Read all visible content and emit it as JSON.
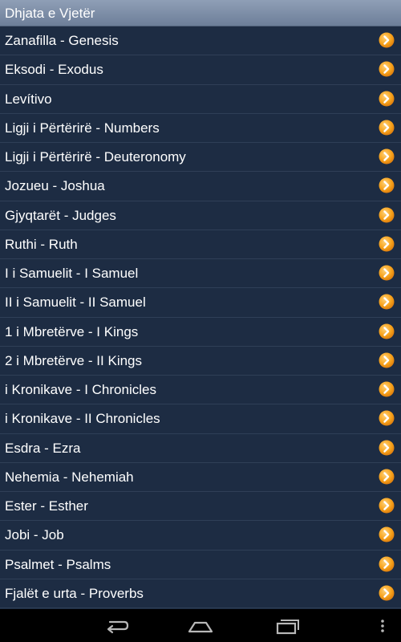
{
  "header": {
    "title": "Dhjata e Vjetër"
  },
  "books": [
    {
      "label": "Zanafilla - Genesis"
    },
    {
      "label": "Eksodi - Exodus"
    },
    {
      "label": "Levítivo"
    },
    {
      "label": "Ligji i Përtërirë - Numbers"
    },
    {
      "label": "Ligji i Përtërirë - Deuteronomy"
    },
    {
      "label": "Jozueu - Joshua"
    },
    {
      "label": "Gjyqtarët - Judges"
    },
    {
      "label": "Ruthi - Ruth"
    },
    {
      "label": "I i Samuelit - I Samuel"
    },
    {
      "label": "II i Samuelit - II Samuel"
    },
    {
      "label": "1 i Mbretërve - I Kings"
    },
    {
      "label": "2 i Mbretërve - II Kings"
    },
    {
      "label": "i Kronikave - I Chronicles"
    },
    {
      "label": "i Kronikave - II Chronicles"
    },
    {
      "label": "Esdra - Ezra"
    },
    {
      "label": "Nehemia - Nehemiah"
    },
    {
      "label": "Ester - Esther"
    },
    {
      "label": "Jobi - Job"
    },
    {
      "label": "Psalmet - Psalms"
    },
    {
      "label": "Fjalët e urta - Proverbs"
    }
  ],
  "icons": {
    "row_arrow": "chevron-right-circle-icon",
    "back": "back-icon",
    "home": "home-icon",
    "recent": "recent-apps-icon",
    "menu": "overflow-menu-icon"
  },
  "colors": {
    "background": "#1d2c43",
    "header": "#7e8fa8",
    "arrow": "#f7a21b",
    "navbar": "#000000"
  }
}
